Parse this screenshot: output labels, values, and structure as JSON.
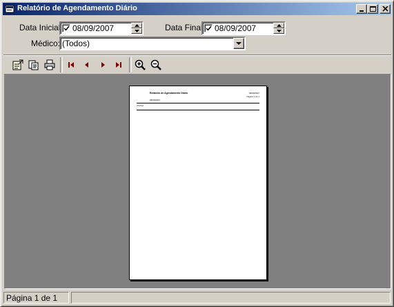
{
  "window": {
    "title": "Relatório de Agendamento Diário"
  },
  "filters": {
    "start_label": "Data Inicial:",
    "start_value": "08/09/2007",
    "start_checked": true,
    "end_label": "Data Final:",
    "end_value": "08/09/2007",
    "end_checked": true,
    "doctor_label": "Médico:",
    "doctor_value": "(Todos)"
  },
  "toolbar": {
    "buttons": [
      "open-report-icon",
      "export-icon",
      "print-icon",
      "first-page-icon",
      "prev-page-icon",
      "next-page-icon",
      "last-page-icon",
      "zoom-in-icon",
      "zoom-out-icon"
    ]
  },
  "status": {
    "page": "Página 1 de 1"
  }
}
